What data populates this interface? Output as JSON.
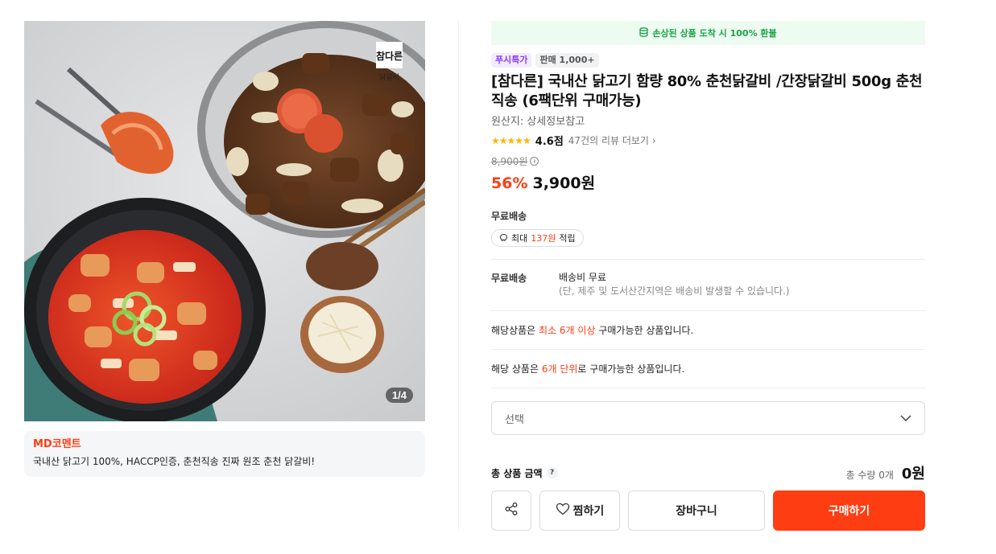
{
  "gallery": {
    "counter": "1/4",
    "brand_mark_top": "참다른",
    "brand_mark_bottom": "닭갈비"
  },
  "md_comment": {
    "title": "MD코멘트",
    "text": "국내산 닭고기 100%, HACCP인증, 춘천직송 진짜 원조 춘천 닭갈비!"
  },
  "refund_banner": {
    "text": "손상된 상품 도착 시 100% 환불",
    "icon": "coins-icon"
  },
  "badges": {
    "push": "푸시특가",
    "sales": "판매 1,000+"
  },
  "product": {
    "title": "[참다른] 국내산 닭고기 함량 80% 춘천닭갈비 /간장닭갈비 500g 춘천직송 (6팩단위 구매가능)",
    "origin": "원산지: 상세정보참고",
    "stars": "★★★★★",
    "rating": "4.6점",
    "reviews": "47건의 리뷰 더보기",
    "original_price": "8,900원",
    "discount": "56%",
    "sale_price": "3,900원"
  },
  "shipping": {
    "label": "무료배송",
    "points_prefix": "최대",
    "points_value": "137원",
    "points_suffix": "적립",
    "detail_label": "무료배송",
    "detail_main": "배송비 무료",
    "detail_sub": "(단, 제주 및 도서산간지역은 배송비 발생할 수 있습니다.)"
  },
  "notices": {
    "min_prefix": "해당상품은",
    "min_highlight": "최소 6개 이상",
    "min_suffix": "구매가능한 상품입니다.",
    "unit_prefix": "해당 상품은",
    "unit_highlight": "6개 단위",
    "unit_suffix": "로 구매가능한 상품입니다."
  },
  "select": {
    "placeholder": "선택"
  },
  "total": {
    "label": "총 상품 금액",
    "help": "?",
    "quantity": "총 수량 0개",
    "price": "0원"
  },
  "buttons": {
    "wish": "찜하기",
    "cart": "장바구니",
    "buy": "구매하기"
  },
  "colors": {
    "accent": "#ff3d12",
    "refund_green": "#1aa34a",
    "push_purple": "#8b3dff",
    "star": "#ffb400"
  }
}
